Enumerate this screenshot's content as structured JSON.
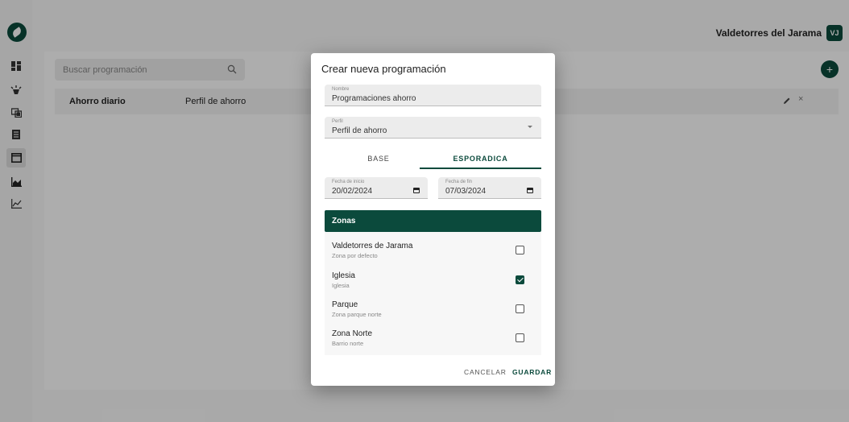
{
  "header": {
    "org_name": "Valdetorres del Jarama",
    "avatar_initials": "VJ"
  },
  "sidebar": {
    "items": [
      {
        "icon": "dashboard-icon"
      },
      {
        "icon": "lamp-icon"
      },
      {
        "icon": "devices-icon"
      },
      {
        "icon": "list-icon"
      },
      {
        "icon": "schedule-icon",
        "active": true
      },
      {
        "icon": "bar-chart-icon"
      },
      {
        "icon": "line-chart-icon"
      }
    ]
  },
  "search": {
    "placeholder": "Buscar programación"
  },
  "table": {
    "rows": [
      {
        "name": "Ahorro diario",
        "profile": "Perfil de ahorro"
      }
    ]
  },
  "dialog": {
    "title": "Crear nueva programación",
    "name_field": {
      "label": "Nombre",
      "value": "Programaciones ahorro"
    },
    "profile_field": {
      "label": "Perfil",
      "value": "Perfil de ahorro"
    },
    "tabs": [
      "BASE",
      "ESPORADICA"
    ],
    "active_tab": "ESPORADICA",
    "start_date": {
      "label": "Fecha de inicio",
      "value": "20/02/2024"
    },
    "end_date": {
      "label": "Fecha de fin",
      "value": "07/03/2024"
    },
    "zones_title": "Zonas",
    "zones": [
      {
        "name": "Valdetorres de Jarama",
        "subtitle": "Zona por defecto",
        "checked": false
      },
      {
        "name": "Iglesia",
        "subtitle": "Iglesia",
        "checked": true
      },
      {
        "name": "Parque",
        "subtitle": "Zona parque norte",
        "checked": false
      },
      {
        "name": "Zona Norte",
        "subtitle": "Barrio norte",
        "checked": false
      }
    ],
    "cancel_label": "CANCELAR",
    "save_label": "GUARDAR"
  },
  "colors": {
    "primary": "#0b4a3c",
    "overlay": "rgba(0,0,0,0.32)"
  }
}
